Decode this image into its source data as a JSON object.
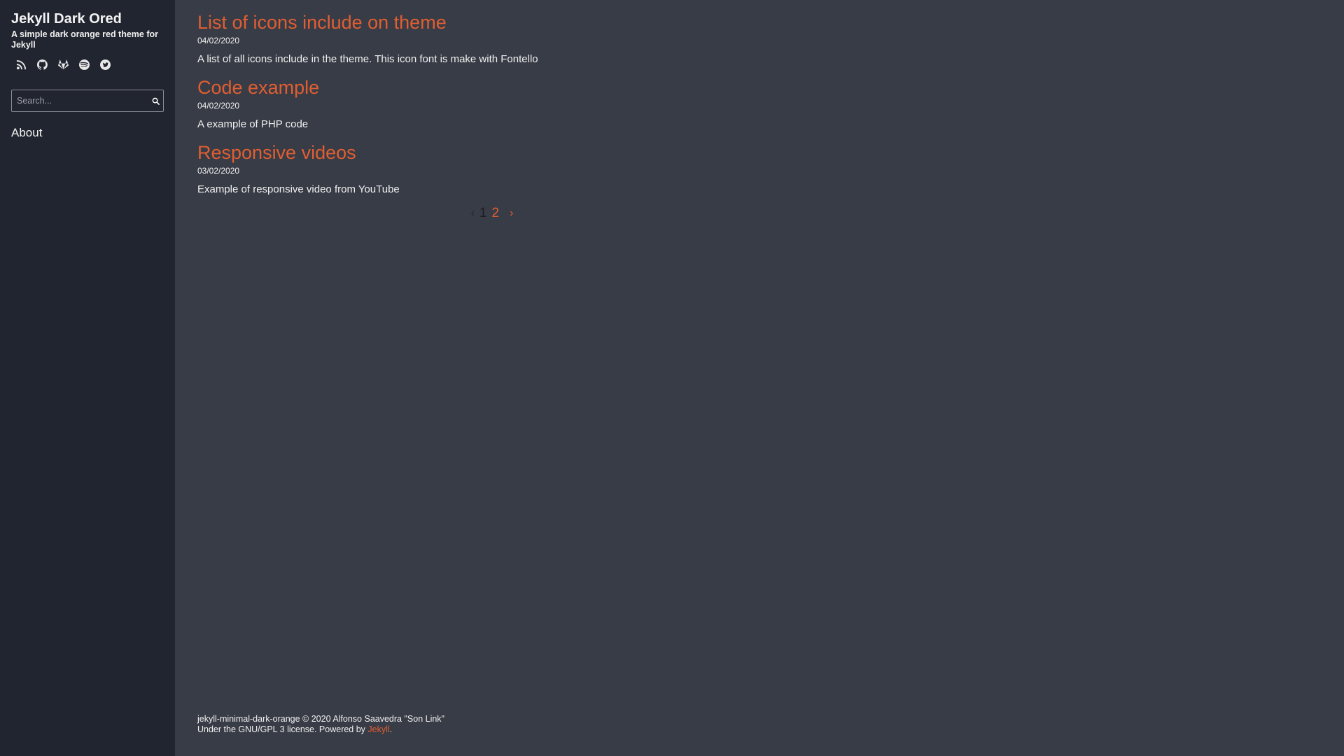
{
  "site": {
    "title": "Jekyll Dark Ored",
    "description": "A simple dark orange red theme for Jekyll"
  },
  "social_icons": [
    "rss-icon",
    "github-icon",
    "gitlab-icon",
    "spotify-icon",
    "twitter-icon"
  ],
  "search": {
    "placeholder": "Search..."
  },
  "nav": {
    "about": "About"
  },
  "posts": [
    {
      "title": "List of icons include on theme",
      "date": "04/02/2020",
      "excerpt": "A list of all icons include in the theme. This icon font is make with Fontello"
    },
    {
      "title": "Code example",
      "date": "04/02/2020",
      "excerpt": "A example of PHP code"
    },
    {
      "title": "Responsive videos",
      "date": "03/02/2020",
      "excerpt": "Example of responsive video from YouTube"
    }
  ],
  "pagination": {
    "prev": "‹",
    "current": "1",
    "page2": "2",
    "next": "›"
  },
  "footer": {
    "line1": "jekyll-minimal-dark-orange © 2020 Alfonso Saavedra \"Son Link\"",
    "line2_prefix": "Under the GNU/GPL 3 license. Powered by ",
    "link": "Jekyll",
    "line2_suffix": "."
  },
  "colors": {
    "accent": "#e05e32",
    "sidebar_bg": "#21252f",
    "main_bg": "#383c46"
  }
}
